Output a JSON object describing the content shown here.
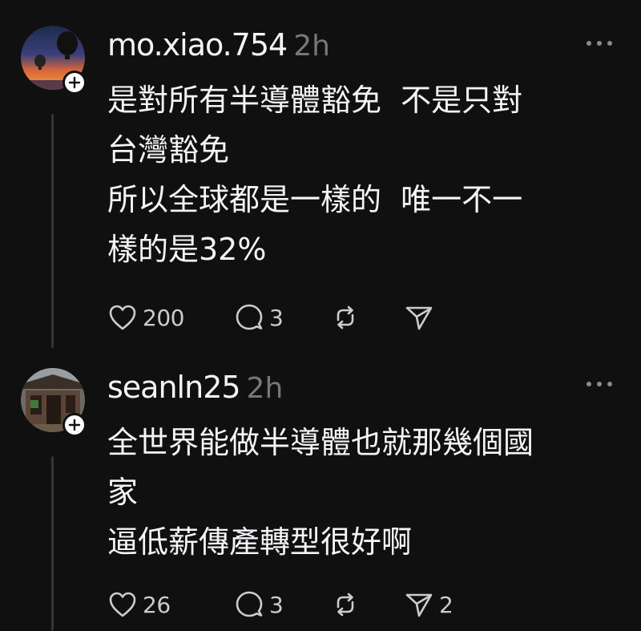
{
  "posts": [
    {
      "username": "mo.xiao.754",
      "time": "2h",
      "content_lines": [
        "是對所有半導體豁免  不是只對",
        "台灣豁免",
        "所以全球都是一樣的  唯一不一",
        "樣的是32%"
      ],
      "likes": "200",
      "replies": "3",
      "reposts": "",
      "shares": ""
    },
    {
      "username": "seanln25",
      "time": "2h",
      "content_lines": [
        "全世界能做半導體也就那幾個國",
        "家",
        "逼低薪傳產轉型很好啊"
      ],
      "likes": "26",
      "replies": "3",
      "reposts": "",
      "shares": "2"
    }
  ],
  "icons": {
    "like": "heart-icon",
    "reply": "speech-bubble-icon",
    "repost": "repost-arrows-icon",
    "share": "paper-plane-icon",
    "more": "more-dots-icon",
    "follow": "plus-icon"
  },
  "colors": {
    "background": "#101010",
    "text": "#f3f5f7",
    "muted": "#777777",
    "thread_line": "#333638"
  }
}
